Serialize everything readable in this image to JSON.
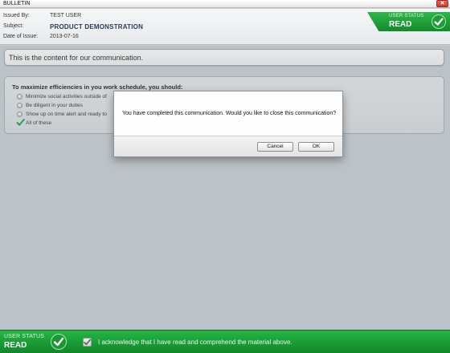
{
  "window": {
    "title": "BULLETIN",
    "close_glyph": "✕"
  },
  "meta": {
    "issued_by_label": "Issued By:",
    "issued_by_value": "TEST USER",
    "subject_label": "Subject:",
    "subject_value": "PRODUCT DEMONSTRATION",
    "date_label": "Date of Issue:",
    "date_value": "2013-07-16"
  },
  "status_top": {
    "label": "USER STATUS",
    "value": "READ",
    "icon": "checkmark-circle-icon"
  },
  "content": {
    "text": "This is the content for our communication."
  },
  "question": {
    "prompt": "To maximize efficiencies in you work schedule, you should:",
    "options": [
      {
        "text": "Minimize social activities outside of",
        "selected": false
      },
      {
        "text": "Be diligent in your duties",
        "selected": false
      },
      {
        "text": "Show up on time alert and ready to",
        "selected": false
      },
      {
        "text": "All of these",
        "selected": true
      }
    ]
  },
  "dialog": {
    "message": "You have completed this communication.  Would you like to close this communication?",
    "cancel_label": "Cancel",
    "ok_label": "OK"
  },
  "bottom": {
    "status_label": "USER STATUS",
    "status_value": "READ",
    "ack_checked": true,
    "ack_text": "I acknowledge that I have read and comprehend the material above."
  },
  "colors": {
    "status_green": "#1a9c38",
    "close_red": "#c9453a",
    "subject_blue": "#2a3c52"
  }
}
